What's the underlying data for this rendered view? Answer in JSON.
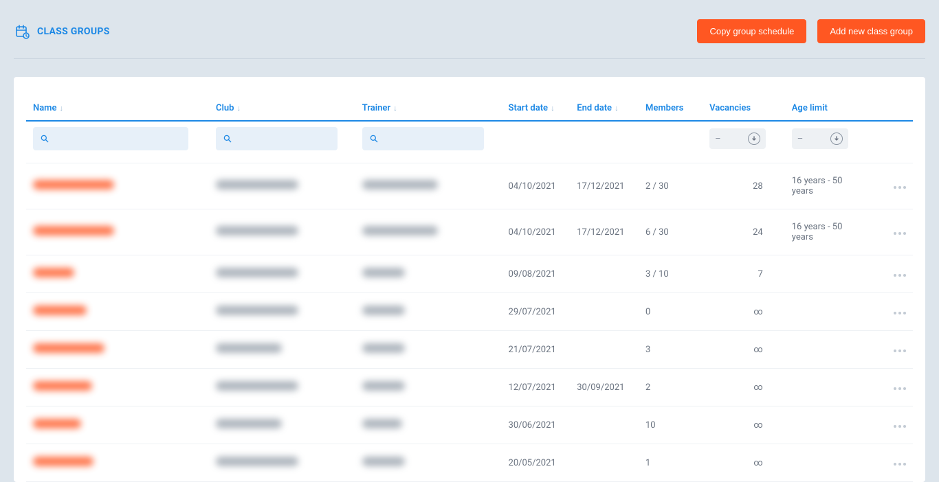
{
  "header": {
    "title": "CLASS GROUPS",
    "btn_copy": "Copy group schedule",
    "btn_add": "Add new class group"
  },
  "columns": {
    "name": "Name",
    "club": "Club",
    "trainer": "Trainer",
    "start": "Start date",
    "end": "End date",
    "members": "Members",
    "vacancies": "Vacancies",
    "age": "Age limit"
  },
  "filters": {
    "range_dash": "–"
  },
  "rows": [
    {
      "name_w": 118,
      "club_w": 120,
      "trainer_w": 110,
      "start": "04/10/2021",
      "end": "17/12/2021",
      "members": "2 / 30",
      "members_link": false,
      "vacancies": "28",
      "age": "16 years - 50 years"
    },
    {
      "name_w": 118,
      "club_w": 120,
      "trainer_w": 110,
      "start": "04/10/2021",
      "end": "17/12/2021",
      "members": "6 / 30",
      "members_link": false,
      "vacancies": "24",
      "age": "16 years - 50 years"
    },
    {
      "name_w": 60,
      "club_w": 120,
      "trainer_w": 62,
      "start": "09/08/2021",
      "end": "",
      "members": "3 / 10",
      "members_link": false,
      "vacancies": "7",
      "age": ""
    },
    {
      "name_w": 78,
      "club_w": 120,
      "trainer_w": 62,
      "start": "29/07/2021",
      "end": "",
      "members": "0",
      "members_link": false,
      "vacancies": "∞",
      "age": ""
    },
    {
      "name_w": 104,
      "club_w": 96,
      "trainer_w": 62,
      "start": "21/07/2021",
      "end": "",
      "members": "3",
      "members_link": true,
      "vacancies": "∞",
      "age": ""
    },
    {
      "name_w": 86,
      "club_w": 120,
      "trainer_w": 62,
      "start": "12/07/2021",
      "end": "30/09/2021",
      "members": "2",
      "members_link": false,
      "vacancies": "∞",
      "age": ""
    },
    {
      "name_w": 70,
      "club_w": 96,
      "trainer_w": 58,
      "start": "30/06/2021",
      "end": "",
      "members": "10",
      "members_link": false,
      "vacancies": "∞",
      "age": ""
    },
    {
      "name_w": 88,
      "club_w": 120,
      "trainer_w": 62,
      "start": "20/05/2021",
      "end": "",
      "members": "1",
      "members_link": false,
      "vacancies": "∞",
      "age": ""
    }
  ]
}
